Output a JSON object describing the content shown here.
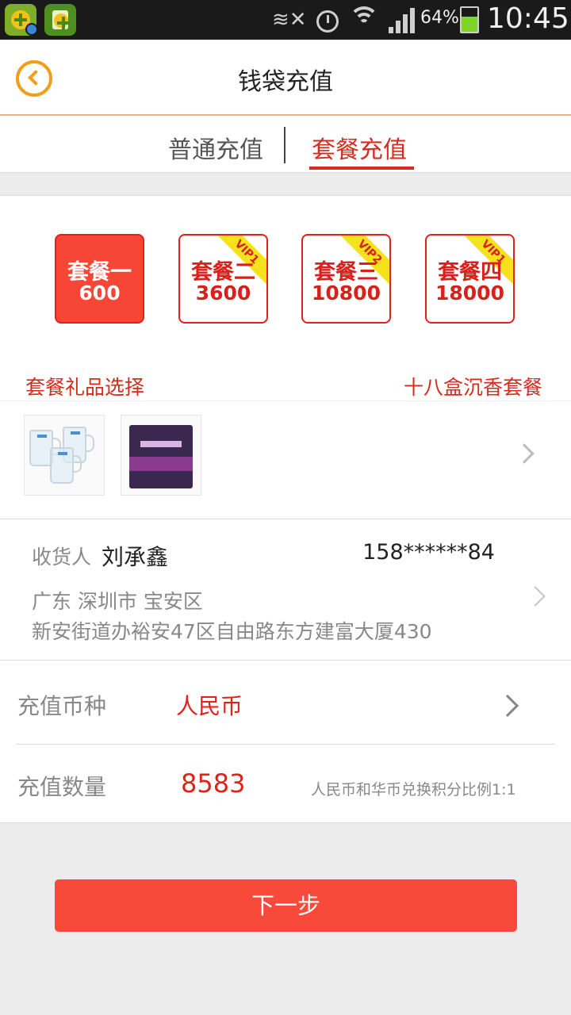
{
  "status_bar": {
    "battery_percent": "64%",
    "time": "10:45",
    "icons": [
      "app-360-icon",
      "app-store-icon",
      "mute-icon",
      "alarm-icon",
      "wifi-icon",
      "signal-icon",
      "battery-icon"
    ],
    "battery_level": 0.64
  },
  "header": {
    "title": "钱袋充值",
    "back_icon": "back-circle-icon",
    "accent_color": "#f29e1a"
  },
  "tabs": [
    {
      "label": "普通充值",
      "selected": false
    },
    {
      "label": "套餐充值",
      "selected": true
    }
  ],
  "packages": [
    {
      "name": "套餐一",
      "amount": "600",
      "badge": "",
      "selected": true
    },
    {
      "name": "套餐二",
      "amount": "3600",
      "badge": "VIP1",
      "selected": false
    },
    {
      "name": "套餐三",
      "amount": "10800",
      "badge": "VIP2",
      "selected": false
    },
    {
      "name": "套餐四",
      "amount": "18000",
      "badge": "VIP1",
      "selected": false
    }
  ],
  "gift": {
    "label": "套餐礼品选择",
    "value": "十八盒沉香套餐",
    "items": [
      "glass-mugs",
      "gift-box"
    ]
  },
  "address": {
    "label": "收货人",
    "name": "刘承鑫",
    "phone": "158******84",
    "region": "广东 深圳市 宝安区",
    "street": "新安街道办裕安47区自由路东方建富大厦430"
  },
  "currency": {
    "label": "充值币种",
    "value": "人民币"
  },
  "amount": {
    "label": "充值数量",
    "value": "8583",
    "note": "人民币和华币兑换积分比例1:1"
  },
  "next_button": {
    "label": "下一步",
    "color": "#f74a3a"
  },
  "colors": {
    "primary_red": "#e3201a",
    "text_red": "#d42c1e",
    "vip_yellow": "#f5e21c"
  }
}
